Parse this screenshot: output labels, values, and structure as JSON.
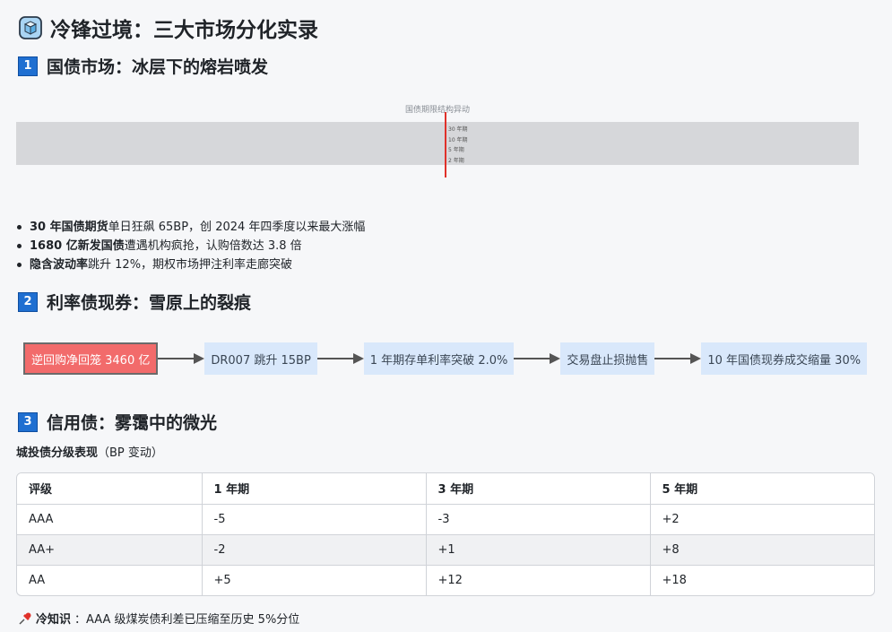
{
  "title": "冷锋过境：三大市场分化实录",
  "sections": [
    {
      "num": "1",
      "title": "国债市场：冰层下的熔岩喷发"
    },
    {
      "num": "2",
      "title": "利率债现券：雪原上的裂痕"
    },
    {
      "num": "3",
      "title": "信用债：雾霭中的微光"
    }
  ],
  "chart": {
    "title": "国债期限结构异动",
    "legend": [
      "30 年期",
      "10 年期",
      "5 年期",
      "2 年期"
    ],
    "colors": {
      "band": "#d6d7da",
      "line": "#e0312a"
    }
  },
  "bullets": [
    {
      "bold": "30 年国债期货",
      "text": "单日狂飙 65BP，创 2024 年四季度以来最大涨幅"
    },
    {
      "bold": "1680 亿新发国债",
      "text": "遭遇机构疯抢，认购倍数达 3.8 倍"
    },
    {
      "bold": "隐含波动率",
      "text": "跳升 12%，期权市场押注利率走廊突破"
    }
  ],
  "flow": [
    {
      "label": "逆回购净回笼 3460 亿",
      "alert": true
    },
    {
      "label": "DR007 跳升 15BP",
      "alert": false
    },
    {
      "label": "1 年期存单利率突破 2.0%",
      "alert": false
    },
    {
      "label": "交易盘止损抛售",
      "alert": false
    },
    {
      "label": "10 年国债现券成交缩量 30%",
      "alert": false
    }
  ],
  "table": {
    "caption_bold": "城投债分级表现",
    "caption_rest": "（BP 变动）",
    "headers": [
      "评级",
      "1 年期",
      "3 年期",
      "5 年期"
    ],
    "rows": [
      [
        "AAA",
        "-5",
        "-3",
        "+2"
      ],
      [
        "AA+",
        "-2",
        "+1",
        "+8"
      ],
      [
        "AA",
        "+5",
        "+12",
        "+18"
      ]
    ]
  },
  "fact": {
    "label": "冷知识",
    "text": "：AAA 级煤炭债利差已压缩至历史 5%分位"
  },
  "icons": {
    "title": "ice-cube-icon",
    "fact": "pushpin-icon"
  },
  "colors": {
    "accent": "#1f6fd1",
    "alert": "#f26b6b",
    "node": "#d9e8fb"
  }
}
